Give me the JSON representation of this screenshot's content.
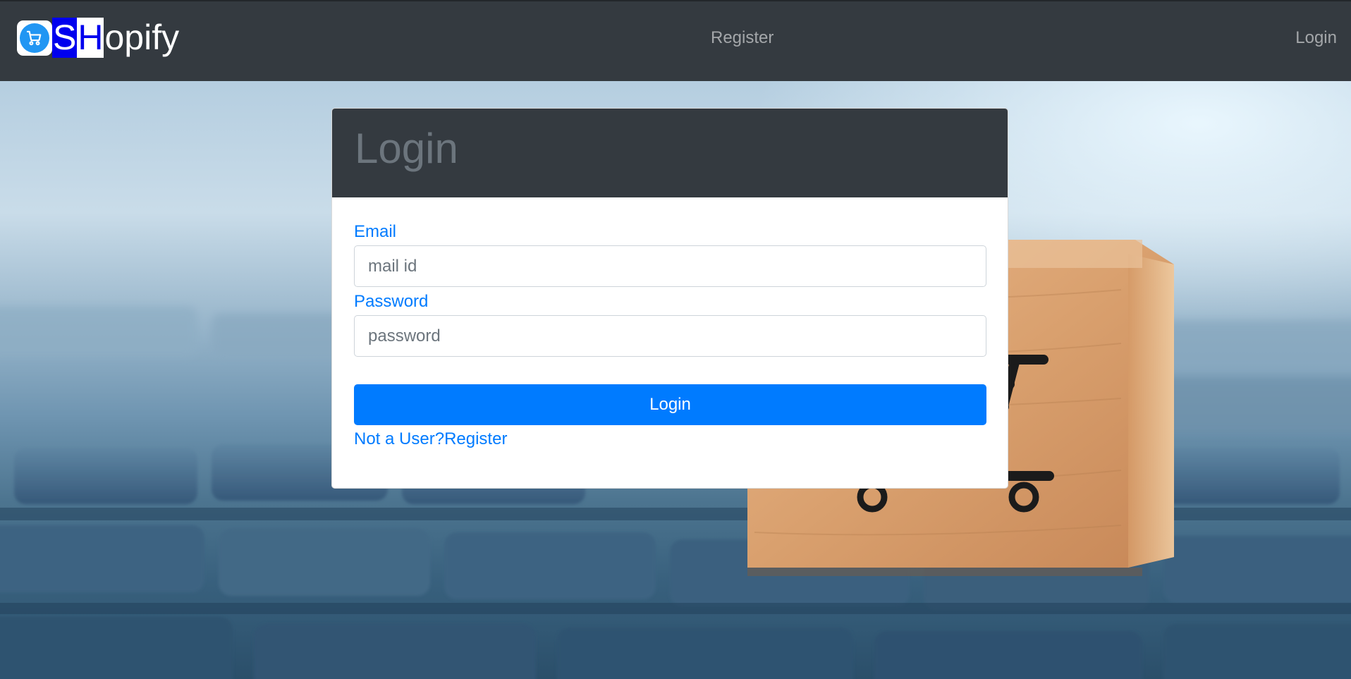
{
  "navbar": {
    "brand_s": "S",
    "brand_h": "H",
    "brand_rest": "opify",
    "logo_icon": "shopping-cart-icon",
    "links": [
      {
        "label": "Register"
      },
      {
        "label": "Login"
      }
    ]
  },
  "login_card": {
    "title": "Login",
    "email_label": "Email",
    "email_placeholder": "mail id",
    "password_label": "Password",
    "password_placeholder": "password",
    "submit_label": "Login",
    "prompt_text": "Not a User?",
    "register_link": "Register"
  },
  "colors": {
    "navbar": "#343a40",
    "primary": "#007bff",
    "brand_blue": "#0000ee"
  }
}
